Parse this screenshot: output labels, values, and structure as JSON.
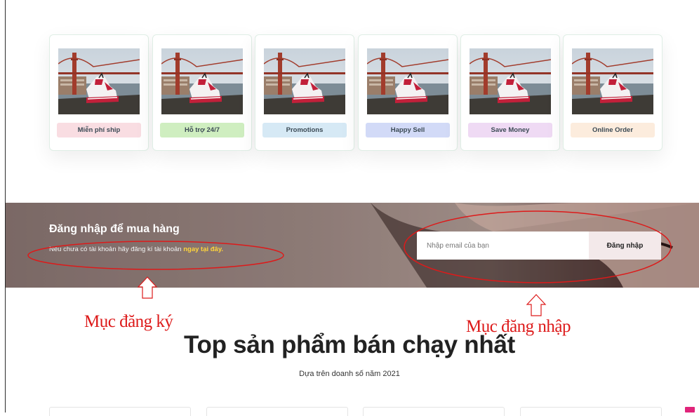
{
  "features": [
    {
      "label": "Miễn phí ship",
      "color": "#f9dde2"
    },
    {
      "label": "Hỗ trợ 24/7",
      "color": "#cfeec0"
    },
    {
      "label": "Promotions",
      "color": "#d6e9f5"
    },
    {
      "label": "Happy Sell",
      "color": "#d2daf7"
    },
    {
      "label": "Save Money",
      "color": "#efdaf4"
    },
    {
      "label": "Online Order",
      "color": "#fcecdd"
    }
  ],
  "banner": {
    "title": "Đăng nhập để mua hàng",
    "subtitle": "Nếu chưa có tài khoản hãy đăng kí tài khoản ",
    "link": "ngay tại đây.",
    "email_placeholder": "Nhập email của bạn",
    "login_label": "Đăng nhập"
  },
  "annotations": {
    "register": "Mục đăng ký",
    "login": "Mục đăng nhập",
    "color": "#dd1a1a"
  },
  "section": {
    "title": "Top sản phẩm bán chạy nhất",
    "subtitle": "Dựa trên doanh số năm 2021"
  }
}
